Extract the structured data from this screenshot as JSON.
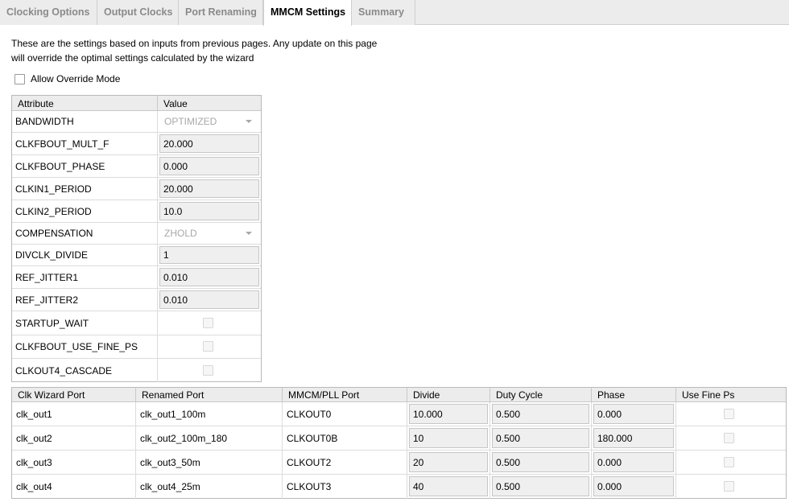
{
  "tabs": [
    {
      "label": "Clocking Options",
      "active": false
    },
    {
      "label": "Output Clocks",
      "active": false
    },
    {
      "label": "Port Renaming",
      "active": false
    },
    {
      "label": "MMCM Settings",
      "active": true
    },
    {
      "label": "Summary",
      "active": false
    }
  ],
  "description": {
    "line1": "These are the settings based on inputs from previous pages. Any update on this page",
    "line2": "will override the optimal settings calculated by the wizard"
  },
  "override": {
    "label": "Allow Override Mode",
    "checked": false
  },
  "attributes": {
    "headers": {
      "attribute": "Attribute",
      "value": "Value"
    },
    "rows": [
      {
        "name": "BANDWIDTH",
        "value": "OPTIMIZED",
        "kind": "select"
      },
      {
        "name": "CLKFBOUT_MULT_F",
        "value": "20.000",
        "kind": "field"
      },
      {
        "name": "CLKFBOUT_PHASE",
        "value": "0.000",
        "kind": "field"
      },
      {
        "name": "CLKIN1_PERIOD",
        "value": "20.000",
        "kind": "field"
      },
      {
        "name": "CLKIN2_PERIOD",
        "value": "10.0",
        "kind": "field"
      },
      {
        "name": "COMPENSATION",
        "value": "ZHOLD",
        "kind": "select"
      },
      {
        "name": "DIVCLK_DIVIDE",
        "value": "1",
        "kind": "field"
      },
      {
        "name": "REF_JITTER1",
        "value": "0.010",
        "kind": "field"
      },
      {
        "name": "REF_JITTER2",
        "value": "0.010",
        "kind": "field"
      },
      {
        "name": "STARTUP_WAIT",
        "value": "",
        "kind": "checkbox"
      },
      {
        "name": "CLKFBOUT_USE_FINE_PS",
        "value": "",
        "kind": "checkbox"
      },
      {
        "name": "CLKOUT4_CASCADE",
        "value": "",
        "kind": "checkbox"
      }
    ]
  },
  "ports": {
    "headers": [
      "Clk Wizard Port",
      "Renamed Port",
      "MMCM/PLL Port",
      "Divide",
      "Duty Cycle",
      "Phase",
      "Use Fine Ps"
    ],
    "rows": [
      {
        "wizard_port": "clk_out1",
        "renamed_port": "clk_out1_100m",
        "mmcm_port": "CLKOUT0",
        "divide": "10.000",
        "duty_cycle": "0.500",
        "phase": "0.000"
      },
      {
        "wizard_port": "clk_out2",
        "renamed_port": "clk_out2_100m_180",
        "mmcm_port": "CLKOUT0B",
        "divide": "10",
        "duty_cycle": "0.500",
        "phase": "180.000"
      },
      {
        "wizard_port": "clk_out3",
        "renamed_port": "clk_out3_50m",
        "mmcm_port": "CLKOUT2",
        "divide": "20",
        "duty_cycle": "0.500",
        "phase": "0.000"
      },
      {
        "wizard_port": "clk_out4",
        "renamed_port": "clk_out4_25m",
        "mmcm_port": "CLKOUT3",
        "divide": "40",
        "duty_cycle": "0.500",
        "phase": "0.000"
      }
    ]
  }
}
